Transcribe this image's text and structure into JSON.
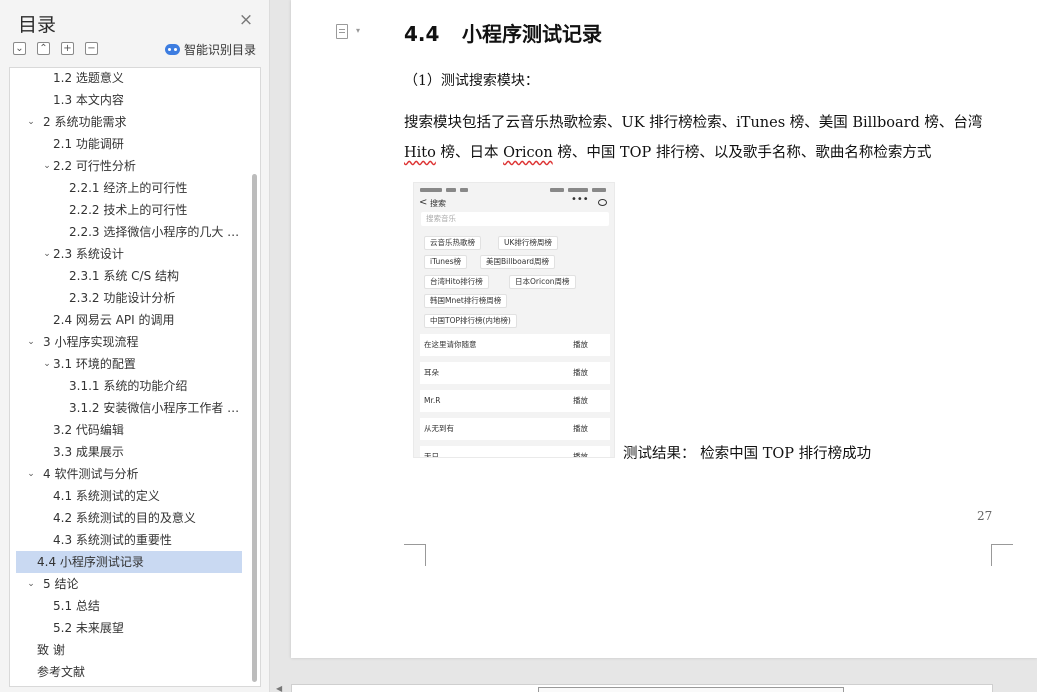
{
  "toc": {
    "title": "目录",
    "close_icon": "×",
    "toolbar": {
      "collapse_all": "⌄",
      "expand_up": "⌃",
      "add": "+",
      "remove": "−"
    },
    "smart_label": "智能识别目录",
    "items": [
      {
        "level": 2,
        "text": "1.2  选题意义",
        "chevron": ""
      },
      {
        "level": 2,
        "text": "1.3  本文内容",
        "chevron": ""
      },
      {
        "level": 1,
        "text": "2  系统功能需求",
        "chevron": "⌄"
      },
      {
        "level": 2,
        "text": "2.1  功能调研",
        "chevron": ""
      },
      {
        "level": 2,
        "text": "2.2  可行性分析",
        "chevron": "⌄"
      },
      {
        "level": 3,
        "text": "2.2.1  经济上的可行性",
        "chevron": ""
      },
      {
        "level": 3,
        "text": "2.2.2  技术上的可行性",
        "chevron": ""
      },
      {
        "level": 3,
        "text": "2.2.3  选择微信小程序的几大 …",
        "chevron": ""
      },
      {
        "level": 2,
        "text": "2.3  系统设计",
        "chevron": "⌄"
      },
      {
        "level": 3,
        "text": "2.3.1     系统 C/S 结构",
        "chevron": ""
      },
      {
        "level": 3,
        "text": "2.3.2  功能设计分析",
        "chevron": ""
      },
      {
        "level": 2,
        "text": "2.4  网易云 API 的调用",
        "chevron": ""
      },
      {
        "level": 1,
        "text": "3  小程序实现流程",
        "chevron": "⌄"
      },
      {
        "level": 2,
        "text": "3.1  环境的配置",
        "chevron": "⌄"
      },
      {
        "level": 3,
        "text": "3.1.1  系统的功能介绍",
        "chevron": ""
      },
      {
        "level": 3,
        "text": "3.1.2  安装微信小程序工作者 …",
        "chevron": ""
      },
      {
        "level": 2,
        "text": "3.2  代码编辑",
        "chevron": ""
      },
      {
        "level": 2,
        "text": "3.3  成果展示",
        "chevron": ""
      },
      {
        "level": 1,
        "text": "4    软件测试与分析",
        "chevron": "⌄"
      },
      {
        "level": 2,
        "text": "4.1    系统测试的定义",
        "chevron": ""
      },
      {
        "level": 2,
        "text": "4.2    系统测试的目的及意义",
        "chevron": ""
      },
      {
        "level": 2,
        "text": "4.3    系统测试的重要性",
        "chevron": ""
      },
      {
        "level": 2,
        "text": "4.4    小程序测试记录",
        "chevron": "",
        "selected": true
      },
      {
        "level": 1,
        "text": "5  结论",
        "chevron": "⌄"
      },
      {
        "level": 2,
        "text": "5.1  总结",
        "chevron": ""
      },
      {
        "level": 2,
        "text": "5.2  未来展望",
        "chevron": ""
      },
      {
        "level": 0,
        "text": "致    谢",
        "chevron": ""
      },
      {
        "level": 0,
        "text": "参考文献",
        "chevron": ""
      }
    ]
  },
  "doc": {
    "section_number": "4.4",
    "section_title": "小程序测试记录",
    "sub_heading": "（1）测试搜索模块：",
    "para_a": "搜索模块包括了云音乐热歌检索、UK 排行榜检索、iTunes 榜、美国 Billboard 榜、台湾 ",
    "para_b": "Hito",
    "para_c": " 榜、日本 ",
    "para_d": "Oricon",
    "para_e": " 榜、中国 TOP 排行榜、以及歌手名称、歌曲名称检索方式",
    "result": "测试结果：  检索中国 TOP 排行榜成功",
    "page_number": "27"
  },
  "phone": {
    "nav_back": "<",
    "nav_title": "搜索",
    "nav_dots": "•••",
    "search_placeholder": "搜索音乐",
    "chips": [
      "云音乐热歌榜",
      "UK排行榜周榜",
      "iTunes榜",
      "美国Billboard周榜",
      "台湾Hito排行榜",
      "日本Oricon周榜",
      "韩国Mnet排行榜周榜",
      "中国TOP排行榜(内地榜)"
    ],
    "songs": [
      {
        "name": "在这里请你随意",
        "play": "播放"
      },
      {
        "name": "耳朵",
        "play": "播放"
      },
      {
        "name": "Mr.R",
        "play": "播放"
      },
      {
        "name": "从无到有",
        "play": "播放"
      },
      {
        "name": "天日",
        "play": "播放"
      }
    ]
  }
}
